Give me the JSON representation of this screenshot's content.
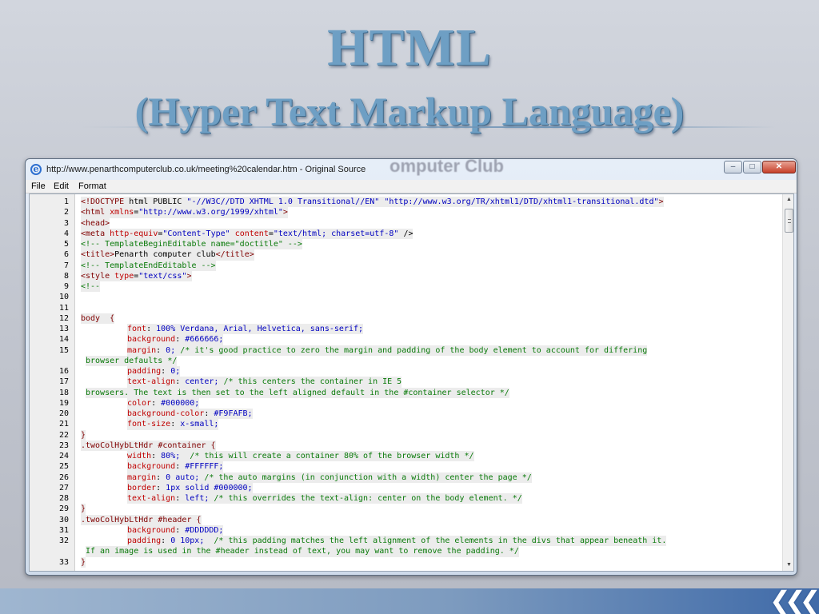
{
  "slide": {
    "title": "HTML",
    "subtitle": "(Hyper Text Markup Language)"
  },
  "window": {
    "title": "http://www.penarthcomputerclub.co.uk/meeting%20calendar.htm - Original Source",
    "background_text": "omputer Club",
    "controls": {
      "minimize": "–",
      "maximize": "□",
      "close": "✕"
    },
    "icon": "ie-icon"
  },
  "menu": [
    "File",
    "Edit",
    "Format"
  ],
  "source_lines": [
    {
      "n": "1",
      "text": "<!DOCTYPE html PUBLIC \"-//W3C//DTD XHTML 1.0 Transitional//EN\" \"http://www.w3.org/TR/xhtml1/DTD/xhtml1-transitional.dtd\">"
    },
    {
      "n": "2",
      "text": "<html xmlns=\"http://www.w3.org/1999/xhtml\">"
    },
    {
      "n": "3",
      "text": "<head>"
    },
    {
      "n": "4",
      "text": "<meta http-equiv=\"Content-Type\" content=\"text/html; charset=utf-8\" />"
    },
    {
      "n": "5",
      "text": "<!-- TemplateBeginEditable name=\"doctitle\" -->"
    },
    {
      "n": "6",
      "text": "<title>Penarth computer club</title>"
    },
    {
      "n": "7",
      "text": "<!-- TemplateEndEditable -->"
    },
    {
      "n": "8",
      "text": "<style type=\"text/css\">"
    },
    {
      "n": "9",
      "text": "<!--"
    },
    {
      "n": "10",
      "text": ""
    },
    {
      "n": "11",
      "text": ""
    },
    {
      "n": "12",
      "text": "body  {"
    },
    {
      "n": "13",
      "text": "font: 100% Verdana, Arial, Helvetica, sans-serif;"
    },
    {
      "n": "14",
      "text": "background: #666666;"
    },
    {
      "n": "15",
      "text": "margin: 0; /* it's good practice to zero the margin and padding of the body element to account for differing"
    },
    {
      "n": "",
      "text": "browser defaults */"
    },
    {
      "n": "16",
      "text": "padding: 0;"
    },
    {
      "n": "17",
      "text": "text-align: center; /* this centers the container in IE 5"
    },
    {
      "n": "18",
      "text": "browsers. The text is then set to the left aligned default in the #container selector */"
    },
    {
      "n": "19",
      "text": "color: #000000;"
    },
    {
      "n": "20",
      "text": "background-color: #F9FAFB;"
    },
    {
      "n": "21",
      "text": "font-size: x-small;"
    },
    {
      "n": "22",
      "text": "}"
    },
    {
      "n": "23",
      "text": ".twoColHybLtHdr #container {"
    },
    {
      "n": "24",
      "text": "width: 80%;  /* this will create a container 80% of the browser width */"
    },
    {
      "n": "25",
      "text": "background: #FFFFFF;"
    },
    {
      "n": "26",
      "text": "margin: 0 auto; /* the auto margins (in conjunction with a width) center the page */"
    },
    {
      "n": "27",
      "text": "border: 1px solid #000000;"
    },
    {
      "n": "28",
      "text": "text-align: left; /* this overrides the text-align: center on the body element. */"
    },
    {
      "n": "29",
      "text": "}"
    },
    {
      "n": "30",
      "text": ".twoColHybLtHdr #header {"
    },
    {
      "n": "31",
      "text": "background: #DDDDDD;"
    },
    {
      "n": "32",
      "text": "padding: 0 10px;  /* this padding matches the left alignment of the elements in the divs that appear beneath it."
    },
    {
      "n": "",
      "text": "If an image is used in the #header instead of text, you may want to remove the padding. */"
    },
    {
      "n": "33",
      "text": "}"
    }
  ],
  "colors": {
    "title": "#6e9fc4",
    "tag": "#800000",
    "attribute": "#c00000",
    "value": "#0000c0",
    "comment": "#0a7a0a"
  }
}
